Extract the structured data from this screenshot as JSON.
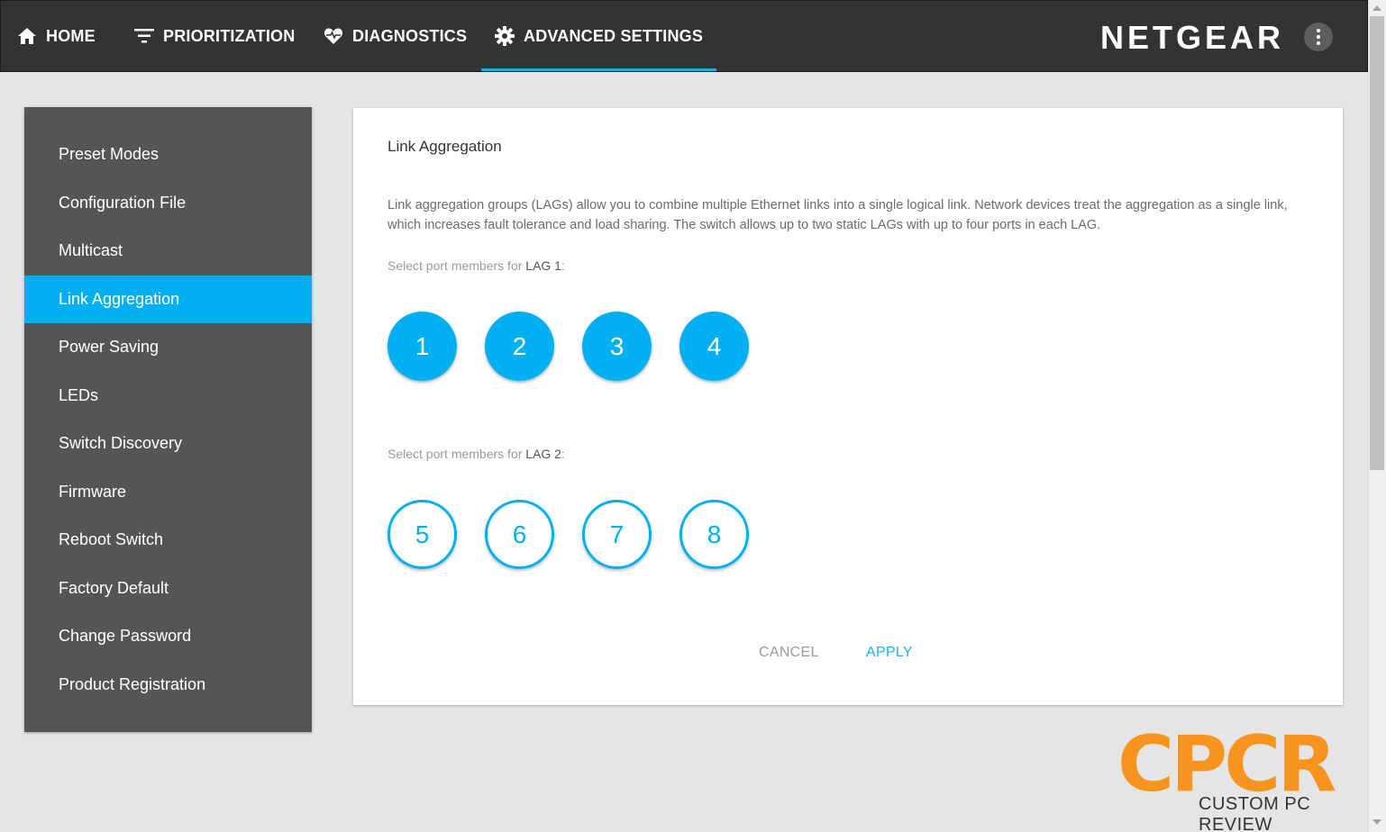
{
  "nav": {
    "items": [
      {
        "label": "HOME",
        "icon": "home-icon"
      },
      {
        "label": "PRIORITIZATION",
        "icon": "filter-icon"
      },
      {
        "label": "DIAGNOSTICS",
        "icon": "heart-pulse-icon"
      },
      {
        "label": "ADVANCED SETTINGS",
        "icon": "gear-icon",
        "active": true
      }
    ],
    "brand": "NETGEAR"
  },
  "sidebar": {
    "items": [
      {
        "label": "Preset Modes"
      },
      {
        "label": "Configuration File"
      },
      {
        "label": "Multicast"
      },
      {
        "label": "Link Aggregation",
        "active": true
      },
      {
        "label": "Power Saving"
      },
      {
        "label": "LEDs"
      },
      {
        "label": "Switch Discovery"
      },
      {
        "label": "Firmware"
      },
      {
        "label": "Reboot Switch"
      },
      {
        "label": "Factory Default"
      },
      {
        "label": "Change Password"
      },
      {
        "label": "Product Registration"
      }
    ]
  },
  "main": {
    "title": "Link Aggregation",
    "description": "Link aggregation groups (LAGs) allow you to combine multiple Ethernet links into a single logical link. Network devices treat the aggregation as a single link, which increases fault tolerance and load sharing. The switch allows up to two static LAGs with up to four ports in each LAG.",
    "lag1": {
      "prefix": "Select port members for ",
      "name": "LAG 1",
      "suffix": ":",
      "ports": [
        {
          "label": "1",
          "selected": true
        },
        {
          "label": "2",
          "selected": true
        },
        {
          "label": "3",
          "selected": true
        },
        {
          "label": "4",
          "selected": true
        }
      ]
    },
    "lag2": {
      "prefix": "Select port members for ",
      "name": "LAG 2",
      "suffix": ":",
      "ports": [
        {
          "label": "5",
          "selected": false
        },
        {
          "label": "6",
          "selected": false
        },
        {
          "label": "7",
          "selected": false
        },
        {
          "label": "8",
          "selected": false
        }
      ]
    },
    "cancel_label": "CANCEL",
    "apply_label": "APPLY"
  },
  "watermark": {
    "letters": "CPCR",
    "subtitle": "CUSTOM PC REVIEW"
  },
  "colors": {
    "accent": "#00b0f0",
    "topbar": "#333333",
    "sidebar": "#555555",
    "watermark": "#f7941d"
  }
}
